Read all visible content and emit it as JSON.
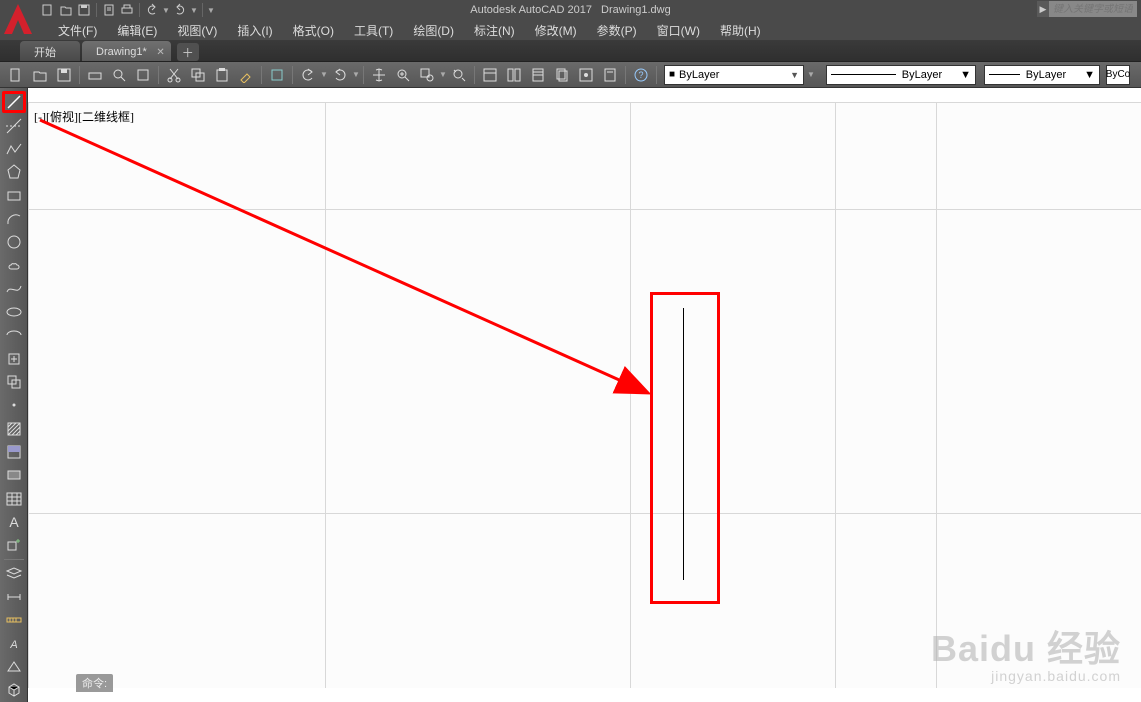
{
  "title": {
    "app": "Autodesk AutoCAD 2017",
    "file": "Drawing1.dwg"
  },
  "search": {
    "placeholder": "键入关键字或短语"
  },
  "menus": {
    "file": "文件(F)",
    "edit": "编辑(E)",
    "view": "视图(V)",
    "insert": "插入(I)",
    "format": "格式(O)",
    "tools": "工具(T)",
    "draw": "绘图(D)",
    "dimension": "标注(N)",
    "modify": "修改(M)",
    "param": "参数(P)",
    "window": "窗口(W)",
    "help": "帮助(H)"
  },
  "tabs": {
    "start": "开始",
    "active": "Drawing1*"
  },
  "props": {
    "layer_prefix": "■",
    "layer": "ByLayer",
    "linetype": "ByLayer",
    "lineweight": "ByLayer",
    "bycolor": "ByCo"
  },
  "viewport": {
    "label": "[-][俯视][二维线框]"
  },
  "cmd": {
    "hist": "命令:",
    "prompt": ""
  },
  "watermark": {
    "main": "Baidu 经验",
    "sub": "jingyan.baidu.com"
  }
}
